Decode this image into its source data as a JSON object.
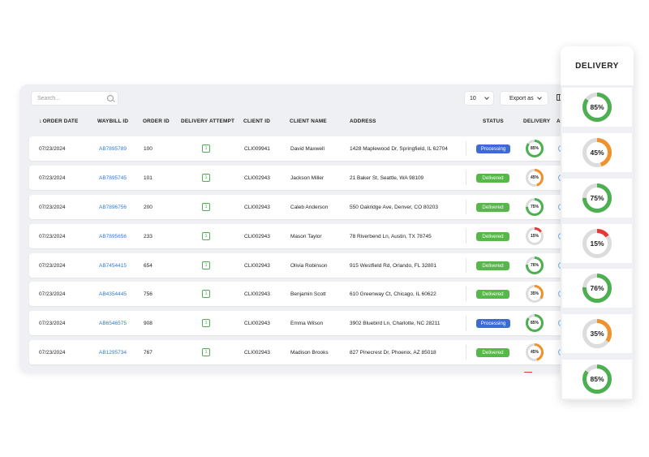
{
  "toolbar": {
    "search_placeholder": "Search...",
    "page_size": "10",
    "export_label": "Export as"
  },
  "columns": [
    "ORDER DATE",
    "WAYBILL ID",
    "ORDER ID",
    "DELIVERY ATTEMPT",
    "CLIENT ID",
    "CLIENT NAME",
    "ADDRESS",
    "STATUS",
    "DELIVERY",
    "AC"
  ],
  "rows": [
    {
      "date": "07/23/2024",
      "waybill": "AB7895789",
      "order_id": "100",
      "attempt": "1",
      "client_id": "CLI009941",
      "client_name": "David Maxwell",
      "address": "1428 Maplewood Dr, Springfield, IL 62704",
      "status": "Processing",
      "delivery": "85%",
      "delivery_value": 85
    },
    {
      "date": "07/23/2024",
      "waybill": "AB7895745",
      "order_id": "101",
      "attempt": "1",
      "client_id": "CLI002943",
      "client_name": "Jackson Miller",
      "address": "21 Baker St, Seattle, WA 98109",
      "status": "Delivered",
      "delivery": "45%",
      "delivery_value": 45
    },
    {
      "date": "07/23/2024",
      "waybill": "AB7896756",
      "order_id": "200",
      "attempt": "1",
      "client_id": "CLI002943",
      "client_name": "Caleb Anderson",
      "address": "550 Oakridge Ave, Denver, CO 80203",
      "status": "Delivered",
      "delivery": "75%",
      "delivery_value": 75
    },
    {
      "date": "07/23/2024",
      "waybill": "AB7895656",
      "order_id": "233",
      "attempt": "1",
      "client_id": "CLI002943",
      "client_name": "Mason Taylor",
      "address": "78 Riverbend Ln, Austin, TX 78745",
      "status": "Delivered",
      "delivery": "15%",
      "delivery_value": 15
    },
    {
      "date": "07/23/2024",
      "waybill": "AB7454415",
      "order_id": "654",
      "attempt": "1",
      "client_id": "CLI002943",
      "client_name": "Olivia Robinson",
      "address": "915 Westfield Rd, Orlando, FL 32801",
      "status": "Delivered",
      "delivery": "76%",
      "delivery_value": 76
    },
    {
      "date": "07/23/2024",
      "waybill": "AB4354445",
      "order_id": "756",
      "attempt": "1",
      "client_id": "CLI002943",
      "client_name": "Benjamin Scott",
      "address": "610 Greenway Ct, Chicago, IL 60622",
      "status": "Delivered",
      "delivery": "35%",
      "delivery_value": 35
    },
    {
      "date": "07/23/2024",
      "waybill": "AB6546575",
      "order_id": "908",
      "attempt": "1",
      "client_id": "CLI002943",
      "client_name": "Emma Wilson",
      "address": "3902 Bluebird Ln, Charlotte, NC 28211",
      "status": "Processing",
      "delivery": "85%",
      "delivery_value": 85
    },
    {
      "date": "07/23/2024",
      "waybill": "AB1295734",
      "order_id": "767",
      "attempt": "1",
      "client_id": "CLI002943",
      "client_name": "Madison Brooks",
      "address": "827 Pinecrest Dr, Phoenix, AZ 85018",
      "status": "Delivered",
      "delivery": "45%",
      "delivery_value": 45
    }
  ],
  "delivery_panel": {
    "title": "DELIVERY",
    "items": [
      {
        "label": "85%",
        "value": 85
      },
      {
        "label": "45%",
        "value": 45
      },
      {
        "label": "75%",
        "value": 75
      },
      {
        "label": "15%",
        "value": 15
      },
      {
        "label": "76%",
        "value": 76
      },
      {
        "label": "35%",
        "value": 35
      },
      {
        "label": "85%",
        "value": 85
      }
    ]
  },
  "colors": {
    "delivered": "#56b848",
    "processing": "#3d6ad6",
    "waybill_link": "#2f7ad8",
    "ring_high": "#4caf50",
    "ring_mid": "#f0922b",
    "ring_low": "#e53935",
    "ring_track": "#dcdcdc"
  }
}
